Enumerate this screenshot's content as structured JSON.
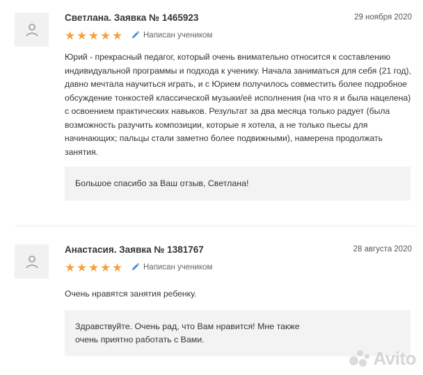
{
  "reviews": [
    {
      "name": "Светлана. Заявка № 1465923",
      "date": "29 ноября 2020",
      "rating": 5,
      "badge": "Написан учеником",
      "text": "Юрий - прекрасный педагог, который очень внимательно относится к составлению индивидуальной программы и подхода к ученику. Начала заниматься для себя (21 год), давно мечтала научиться играть, и с Юрием получилось совместить более подробное обсуждение тонкостей классической музыки/её исполнения (на что я и была нацелена) с освоением практических навыков. Результат за два месяца только радует (была возможность разучить композиции, которые я хотела, а не только пьесы для начинающих; пальцы стали заметно более подвижными), намерена продолжать занятия.",
      "reply": "Большое спасибо за Ваш отзыв, Светлана!"
    },
    {
      "name": "Анастасия. Заявка № 1381767",
      "date": "28 августа 2020",
      "rating": 5,
      "badge": "Написан учеником",
      "text": "Очень нравятся занятия ребенку.",
      "reply": "Здравствуйте. Очень рад, что Вам нравится! Мне также очень приятно работать с Вами."
    }
  ],
  "watermark": "Avito",
  "colors": {
    "star": "#f7a13c",
    "reply_bg": "#f3f3f3",
    "avatar_bg": "#f1f1f1"
  },
  "icons": {
    "avatar": "user-icon",
    "badge": "pencil-icon",
    "star": "star-icon"
  }
}
